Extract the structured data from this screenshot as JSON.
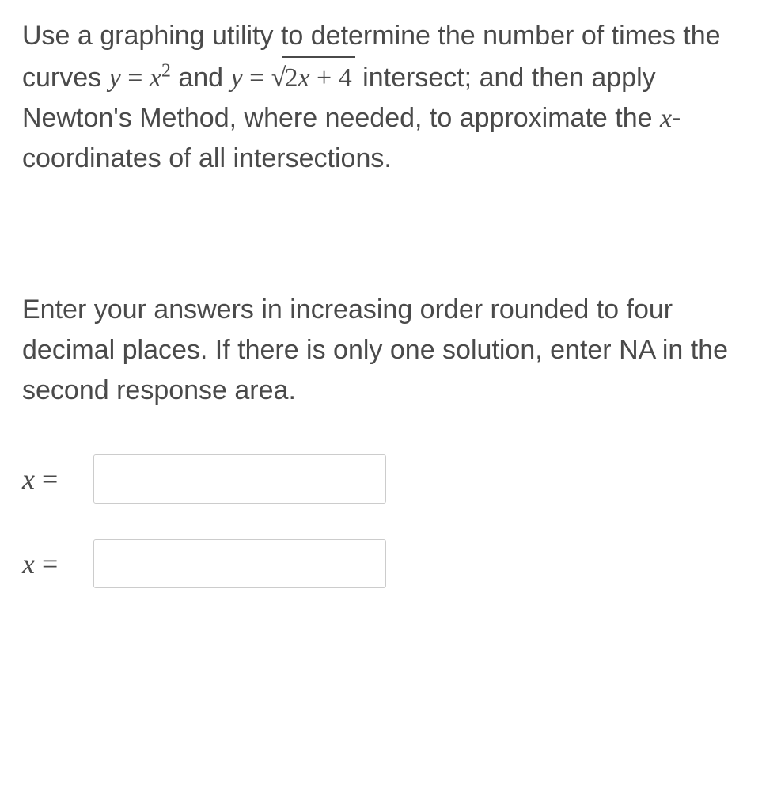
{
  "question": {
    "part1": "Use a graphing utility to determine the number of times the curves ",
    "eq1_y": "y",
    "eq1_eq": " = ",
    "eq1_x": "x",
    "eq1_exp": "2",
    "conjunction": " and ",
    "eq2_y": "y",
    "eq2_eq": " = ",
    "sqrt_prefix": "√",
    "eq2_inner_coef": "2",
    "eq2_inner_x": "x",
    "eq2_inner_plus": " + 4",
    "part2": " intersect; and then apply Newton's Method, where needed, to approximate the ",
    "xvar": "x",
    "part3": "-coordinates of all intersections."
  },
  "instructions": "Enter your answers in increasing order rounded to four decimal places. If there is only one solution, enter NA in the second response area.",
  "answers": {
    "label1_x": "x",
    "label1_eq": " =",
    "label2_x": "x",
    "label2_eq": " =",
    "value1": "",
    "value2": ""
  }
}
